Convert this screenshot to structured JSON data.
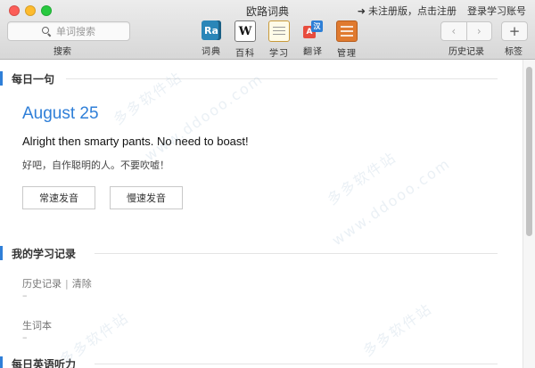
{
  "window": {
    "title": "欧路词典"
  },
  "top_links": {
    "unregistered": "未注册版，点击注册",
    "login": "登录学习账号"
  },
  "search": {
    "placeholder": "单词搜索",
    "label": "搜索"
  },
  "toolbar": {
    "items": [
      {
        "icon": "Ra",
        "label": "词典"
      },
      {
        "icon": "W",
        "label": "百科"
      },
      {
        "icon": "",
        "label": "学习"
      },
      {
        "icon_a": "A",
        "icon_b": "汉",
        "label": "翻译"
      },
      {
        "icon": "",
        "label": "管理"
      }
    ],
    "history_label": "历史记录",
    "tags_label": "标签",
    "back": "‹",
    "forward": "›",
    "add": "+"
  },
  "daily": {
    "title": "每日一句",
    "date": "August 25",
    "sentence_en": "Alright then smarty pants. No need to boast!",
    "sentence_cn": "好吧，自作聪明的人。不要吹嘘！",
    "btn_normal": "常速发音",
    "btn_slow": "慢速发音"
  },
  "records": {
    "title": "我的学习记录",
    "history_label": "历史记录",
    "separator": "|",
    "clear": "清除",
    "history_value": "–",
    "wordbook_label": "生词本",
    "wordbook_value": "–"
  },
  "listening": {
    "title": "每日英语听力"
  },
  "watermark": {
    "text_cn": "多多软件站",
    "text_url": "www.ddooo.com"
  },
  "colors": {
    "accent": "#2f7fd8"
  }
}
